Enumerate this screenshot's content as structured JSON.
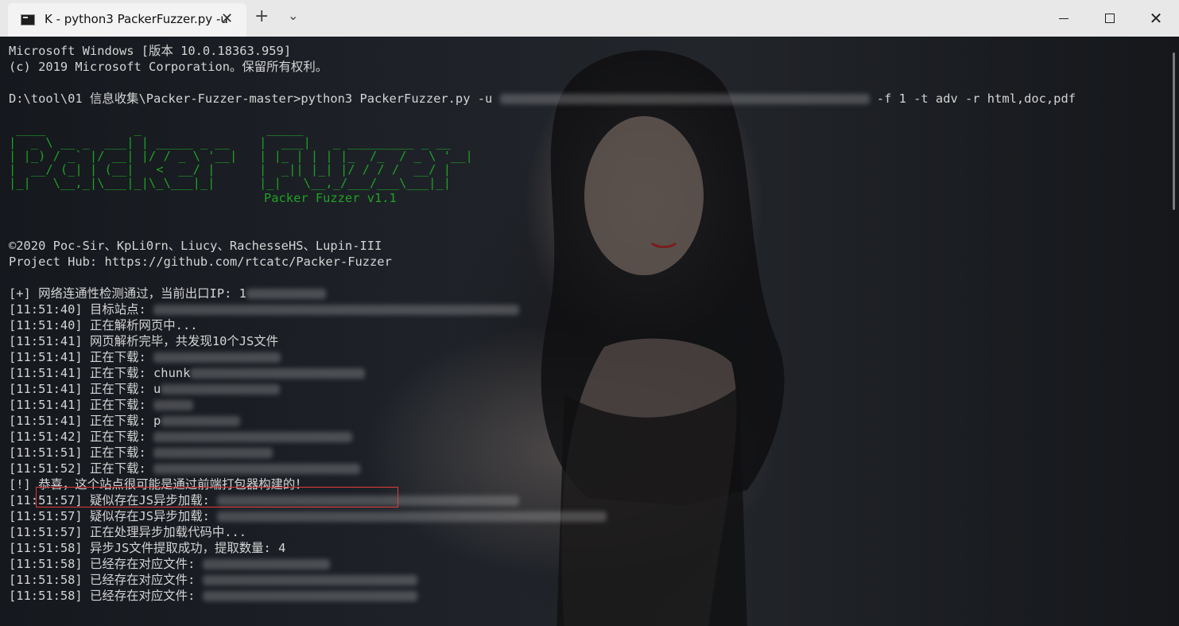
{
  "window": {
    "tab_title": "K - python3  PackerFuzzer.py -u",
    "tab_close_glyph": "✕",
    "new_tab_glyph": "+",
    "tab_menu_glyph": "⌄",
    "close_glyph": "✕"
  },
  "colors": {
    "terminal_text": "#d4d4d4",
    "banner_green": "#1fa124",
    "highlight_border": "#e33b3b",
    "titlebar": "#e8e8e8"
  },
  "terminal": {
    "header": [
      "Microsoft Windows [版本 10.0.18363.959]",
      "(c) 2019 Microsoft Corporation。保留所有权利。"
    ],
    "command_prefix": "D:\\tool\\01 信息收集\\Packer-Fuzzer-master>python3 PackerFuzzer.py -u ",
    "command_suffix": " -f 1 -t adv -r html,doc,pdf",
    "banner_ascii": " ____            _                 _____\n|  _ \\ __ _  ___| | _____ _ __    |  ___|   _ _________ _ __\n| |_) / _` |/ __| |/ / _ \\ '__|   | |_ | | | |_  /_  / _ \\ '__|\n|  __/ (_| | (__|   <  __/ |      |  _|| |_| |/ / / /  __/ |\n|_|   \\__,_|\\___|_|\\_\\___|_|      |_|   \\__,_/___/___\\___|_|",
    "banner_version": "Packer Fuzzer v1.1",
    "credits": [
      "©2020 Poc-Sir、KpLi0rn、Liucy、RachesseHS、Lupin-III",
      "Project Hub: https://github.com/rtcatc/Packer-Fuzzer"
    ],
    "log": [
      {
        "prefix": "[+] ",
        "text": "网络连通性检测通过，当前出口IP: 1"
      },
      {
        "prefix": "[11:51:40] ",
        "text": "目标站点: "
      },
      {
        "prefix": "[11:51:40] ",
        "text": "正在解析网页中..."
      },
      {
        "prefix": "[11:51:41] ",
        "text": "网页解析完毕，共发现10个JS文件"
      },
      {
        "prefix": "[11:51:41] ",
        "text": "正在下载: "
      },
      {
        "prefix": "[11:51:41] ",
        "text": "正在下载: chunk"
      },
      {
        "prefix": "[11:51:41] ",
        "text": "正在下载: u"
      },
      {
        "prefix": "[11:51:41] ",
        "text": "正在下载: "
      },
      {
        "prefix": "[11:51:41] ",
        "text": "正在下载: p"
      },
      {
        "prefix": "[11:51:42] ",
        "text": "正在下载: "
      },
      {
        "prefix": "[11:51:51] ",
        "text": "正在下载: "
      },
      {
        "prefix": "[11:51:52] ",
        "text": "正在下载: "
      },
      {
        "prefix": "[!] ",
        "text": "恭喜，这个站点很可能是通过前端打包器构建的！"
      },
      {
        "prefix": "[11:51:57] ",
        "text": "疑似存在JS异步加载: "
      },
      {
        "prefix": "[11:51:57] ",
        "text": "疑似存在JS异步加载: "
      },
      {
        "prefix": "[11:51:57] ",
        "text": "正在处理异步加载代码中..."
      },
      {
        "prefix": "[11:51:58] ",
        "text": "异步JS文件提取成功，提取数量: 4"
      },
      {
        "prefix": "[11:51:58] ",
        "text": "已经存在对应文件: "
      },
      {
        "prefix": "[11:51:58] ",
        "text": "已经存在对应文件: "
      },
      {
        "prefix": "[11:51:58] ",
        "text": "已经存在对应文件: "
      }
    ]
  }
}
